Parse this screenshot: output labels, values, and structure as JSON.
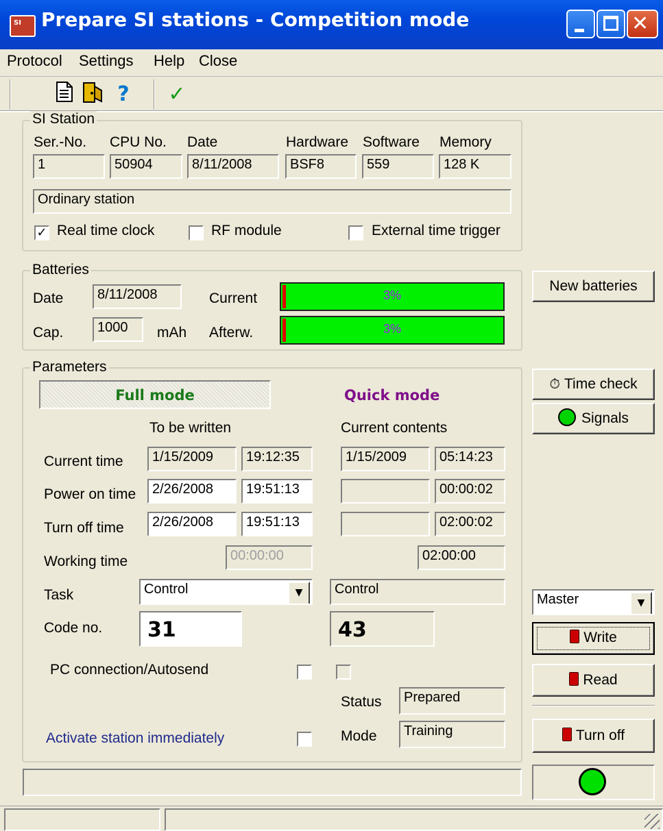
{
  "window": {
    "title": "Prepare SI stations - Competition mode",
    "app_icon_text": "SI"
  },
  "menu": [
    "Protocol",
    "Settings",
    "Help",
    "Close"
  ],
  "toolbar": {
    "icons": [
      "document-icon",
      "exit-door-icon",
      "help-icon",
      "checkmark-icon"
    ],
    "help_glyph": "?",
    "check_glyph": "✓"
  },
  "si_station": {
    "legend": "SI Station",
    "headers": {
      "serno": "Ser.-No.",
      "cpu": "CPU No.",
      "date": "Date",
      "hardware": "Hardware",
      "software": "Software",
      "memory": "Memory"
    },
    "values": {
      "serno": "1",
      "cpu": "50904",
      "date": "8/11/2008",
      "hardware": "BSF8",
      "software": "559",
      "memory": "128 K"
    },
    "type": "Ordinary station",
    "checks": [
      {
        "label": "Real time clock",
        "checked": true
      },
      {
        "label": "RF module",
        "checked": false
      },
      {
        "label": "External time trigger",
        "checked": false
      }
    ]
  },
  "batteries": {
    "legend": "Batteries",
    "date_label": "Date",
    "date": "8/11/2008",
    "cap_label": "Cap.",
    "cap": "1000",
    "cap_unit": "mAh",
    "current_label": "Current",
    "current_pct": "3%",
    "current_level": 0.03,
    "after_label": "Afterw.",
    "after_pct": "3%",
    "after_level": 0.03,
    "new_batteries_button": "New batteries"
  },
  "parameters": {
    "legend": "Parameters",
    "full_mode": "Full mode",
    "quick_mode": "Quick mode",
    "col_write": "To be written",
    "col_current": "Current contents",
    "rows": {
      "current_time": {
        "label": "Current time",
        "w_date": "1/15/2009",
        "w_time": "19:12:35",
        "c_date": "1/15/2009",
        "c_time": "05:14:23"
      },
      "power_on": {
        "label": "Power on time",
        "w_date": "2/26/2008",
        "w_time": "19:51:13",
        "c_date": "",
        "c_time": "00:00:02"
      },
      "turn_off": {
        "label": "Turn off time",
        "w_date": "2/26/2008",
        "w_time": "19:51:13",
        "c_date": "",
        "c_time": "02:00:02"
      },
      "working": {
        "label": "Working time",
        "w_time": "00:00:00",
        "c_time": "02:00:00"
      }
    },
    "task_label": "Task",
    "task_value": "Control",
    "task_current": "Control",
    "code_label": "Code no.",
    "code_value": "31",
    "code_current": "43",
    "pc_label": "PC connection/Autosend",
    "status_label": "Status",
    "status_value": "Prepared",
    "mode_label": "Mode",
    "mode_value": "Training",
    "activate_label": "Activate station immediately"
  },
  "side": {
    "time_check": "Time check",
    "signals": "Signals",
    "master_select": "Master",
    "write": "Write",
    "read": "Read",
    "turn_off": "Turn off"
  },
  "colors": {
    "title_bar": "#0046d8",
    "battery_bar": "#00f000",
    "full_mode": "#1a7a1a",
    "quick_mode": "#7f0f8a",
    "activate_link": "#1f2a8c"
  }
}
